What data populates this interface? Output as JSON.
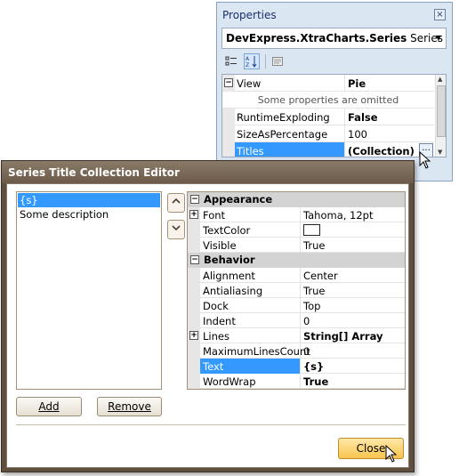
{
  "properties_window": {
    "title": "Properties",
    "close_glyph": "×",
    "object_selector": {
      "bold": "DevExpress.XtraCharts.Series",
      "type": "Series"
    },
    "toolbar": {
      "categorized": "categorized-icon",
      "alphabetical": "alphabetical-sort-icon",
      "pages": "property-pages-icon"
    },
    "grid": {
      "rows": [
        {
          "name": "View",
          "value": "Pie",
          "expandable": true
        },
        {
          "hint": "Some properties are omitted"
        },
        {
          "name": "RuntimeExploding",
          "value": "False"
        },
        {
          "name": "SizeAsPercentage",
          "value": "100"
        },
        {
          "name": "Titles",
          "value": "(Collection)",
          "selected": true,
          "ellipsis": "..."
        }
      ]
    }
  },
  "editor": {
    "title": "Series Title Collection Editor",
    "titles": [
      "{s}",
      "Some description"
    ],
    "selected_index": 0,
    "property_grid": {
      "categories": [
        {
          "name": "Appearance",
          "rows": [
            {
              "name": "Font",
              "value": "Tahoma, 12pt",
              "expandable": true
            },
            {
              "name": "TextColor",
              "value": "",
              "swatch": "#ffffff"
            },
            {
              "name": "Visible",
              "value": "True"
            }
          ]
        },
        {
          "name": "Behavior",
          "rows": [
            {
              "name": "Alignment",
              "value": "Center"
            },
            {
              "name": "Antialiasing",
              "value": "True"
            },
            {
              "name": "Dock",
              "value": "Top"
            },
            {
              "name": "Indent",
              "value": "0"
            },
            {
              "name": "Lines",
              "value": "String[] Array",
              "expandable": true,
              "bold": true
            },
            {
              "name": "MaximumLinesCount",
              "value": "0"
            },
            {
              "name": "Text",
              "value": "{s}",
              "selected": true,
              "bold": true
            },
            {
              "name": "WordWrap",
              "value": "True",
              "bold": true
            }
          ]
        }
      ]
    },
    "buttons": {
      "add": "Add",
      "remove": "Remove",
      "close": "Close"
    }
  },
  "colors": {
    "selection": "#3399ff",
    "dialog_frame": "#5e4f3e",
    "close_button": "#f7c44e"
  }
}
